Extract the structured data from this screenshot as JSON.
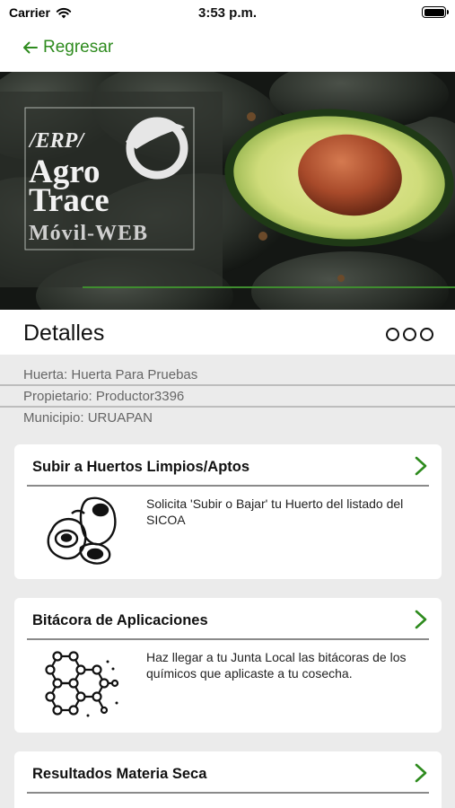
{
  "status_bar": {
    "carrier": "Carrier",
    "time": "3:53 p.m."
  },
  "nav": {
    "back_label": "Regresar",
    "accent": "#2e8b1e"
  },
  "banner": {
    "logo_line1": "/ERP/",
    "logo_line2": "Agro",
    "logo_line3": "Trace",
    "logo_line4": "Móvil-WEB"
  },
  "details": {
    "title": "Detalles"
  },
  "info": {
    "huerta": "Huerta: Huerta Para Pruebas",
    "propietario": "Propietario: Productor3396",
    "municipio": "Municipio: URUAPAN"
  },
  "cards": [
    {
      "title": "Subir a Huertos Limpios/Aptos",
      "description": "Solicita 'Subir o Bajar' tu Huerto del listado del SICOA",
      "icon": "avocado-icon"
    },
    {
      "title": "Bitácora de Aplicaciones",
      "description": "Haz llegar a tu Junta Local las bitácoras de los químicos que aplicaste a tu cosecha.",
      "icon": "molecule-icon"
    },
    {
      "title": "Resultados Materia Seca",
      "description": "",
      "icon": "chevron-right-icon"
    }
  ]
}
